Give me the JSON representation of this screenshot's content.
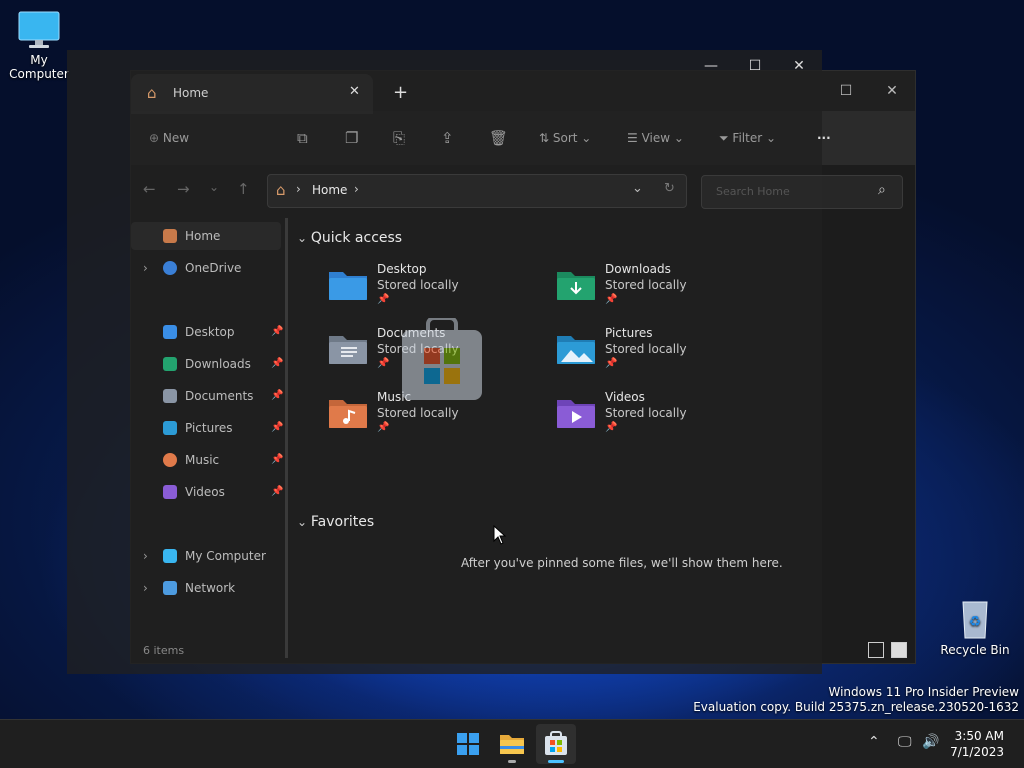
{
  "desktop": {
    "my_computer_label": "My Computer",
    "recycle_bin_label": "Recycle Bin",
    "watermark_line1": "Windows 11 Pro Insider Preview",
    "watermark_line2": "Evaluation copy. Build 25375.zn_release.230520-1632"
  },
  "explorer": {
    "tab_title": "Home",
    "toolbar": {
      "new_label": "New",
      "sort_label": "Sort",
      "view_label": "View",
      "filter_label": "Filter",
      "more_label": "···"
    },
    "address": {
      "crumb": "Home"
    },
    "search_placeholder": "Search Home",
    "sidebar": {
      "home": "Home",
      "onedrive": "OneDrive",
      "desktop": "Desktop",
      "downloads": "Downloads",
      "documents": "Documents",
      "pictures": "Pictures",
      "music": "Music",
      "videos": "Videos",
      "my_computer": "My Computer",
      "network": "Network"
    },
    "quick_access_title": "Quick access",
    "favorites_title": "Favorites",
    "favorites_empty": "After you've pinned some files, we'll show them here.",
    "folders": {
      "desktop": {
        "name": "Desktop",
        "status": "Stored locally"
      },
      "downloads": {
        "name": "Downloads",
        "status": "Stored locally"
      },
      "documents": {
        "name": "Documents",
        "status": "Stored locally"
      },
      "pictures": {
        "name": "Pictures",
        "status": "Stored locally"
      },
      "music": {
        "name": "Music",
        "status": "Stored locally"
      },
      "videos": {
        "name": "Videos",
        "status": "Stored locally"
      }
    },
    "status_items": "6 items"
  },
  "taskbar": {
    "time": "3:50 AM",
    "date": "7/1/2023"
  },
  "colors": {
    "accent": "#0078d4",
    "folder_blue": "#3a8ee6",
    "folder_green": "#23a36f",
    "folder_orange": "#e07a4a",
    "folder_purple": "#8a5cd6"
  }
}
